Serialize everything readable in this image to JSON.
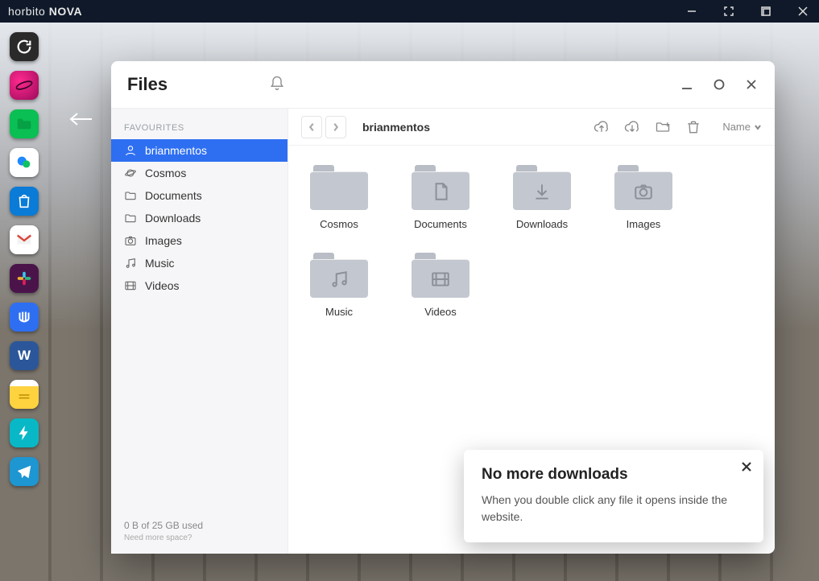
{
  "titlebar": {
    "brand_prefix": "horbito",
    "brand_suffix": " NOVA"
  },
  "dock": {
    "apps": [
      {
        "name": "refresh",
        "bg": "#2a2a2a"
      },
      {
        "name": "planet",
        "bg": "#d70e69"
      },
      {
        "name": "files",
        "bg": "#0abf53"
      },
      {
        "name": "chat",
        "bg": "#ffffff"
      },
      {
        "name": "store",
        "bg": "#0a7bd6"
      },
      {
        "name": "gmail",
        "bg": "#ffffff"
      },
      {
        "name": "slack",
        "bg": "#4a144b"
      },
      {
        "name": "intercom",
        "bg": "#2e6ff2"
      },
      {
        "name": "word",
        "bg": "#2b579a"
      },
      {
        "name": "notes",
        "bg": "#ffd23f"
      },
      {
        "name": "power",
        "bg": "#09b8c6"
      },
      {
        "name": "telegram",
        "bg": "#1e96d1"
      }
    ]
  },
  "window": {
    "title": "Files",
    "sort_label": "Name"
  },
  "sidebar": {
    "section": "FAVOURITES",
    "items": [
      {
        "label": "brianmentos",
        "icon": "user",
        "active": true
      },
      {
        "label": "Cosmos",
        "icon": "planet"
      },
      {
        "label": "Documents",
        "icon": "folder"
      },
      {
        "label": "Downloads",
        "icon": "folder"
      },
      {
        "label": "Images",
        "icon": "camera"
      },
      {
        "label": "Music",
        "icon": "music"
      },
      {
        "label": "Videos",
        "icon": "video"
      }
    ],
    "storage_line": "0 B of 25 GB used",
    "upsell": "Need more space?"
  },
  "breadcrumb": "brianmentos",
  "folders": [
    {
      "label": "Cosmos",
      "glyph": "none"
    },
    {
      "label": "Documents",
      "glyph": "doc"
    },
    {
      "label": "Downloads",
      "glyph": "download"
    },
    {
      "label": "Images",
      "glyph": "camera"
    },
    {
      "label": "Music",
      "glyph": "music"
    },
    {
      "label": "Videos",
      "glyph": "video"
    }
  ],
  "toast": {
    "title": "No more downloads",
    "body": "When you double click any file it opens inside the website."
  }
}
